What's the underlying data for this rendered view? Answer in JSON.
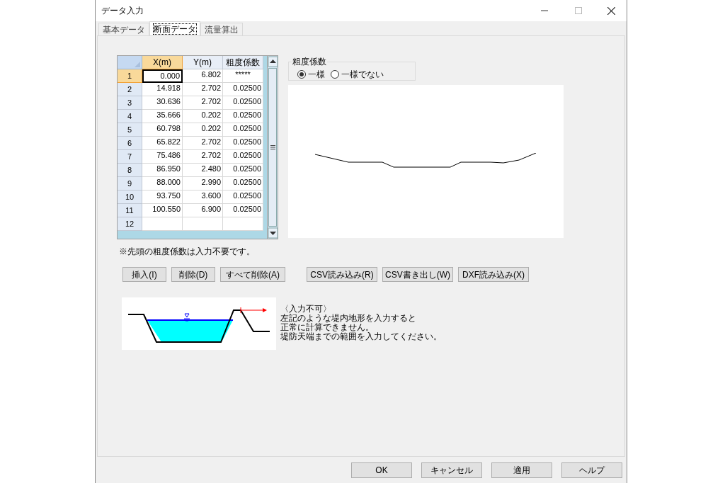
{
  "window": {
    "title": "データ入力"
  },
  "tabs": [
    {
      "label": "基本データ",
      "selected": false
    },
    {
      "label": "断面データ",
      "selected": true
    },
    {
      "label": "流量算出",
      "selected": false
    }
  ],
  "table": {
    "columns": [
      {
        "label": "X(m)",
        "selected": true
      },
      {
        "label": "Y(m)",
        "selected": false
      },
      {
        "label": "粗度係数",
        "selected": false
      }
    ],
    "rows": [
      {
        "number": "1",
        "selected": true,
        "cells": [
          "0.000",
          "6.802",
          "*****"
        ]
      },
      {
        "number": "2",
        "selected": false,
        "cells": [
          "14.918",
          "2.702",
          "0.02500"
        ]
      },
      {
        "number": "3",
        "selected": false,
        "cells": [
          "30.636",
          "2.702",
          "0.02500"
        ]
      },
      {
        "number": "4",
        "selected": false,
        "cells": [
          "35.666",
          "0.202",
          "0.02500"
        ]
      },
      {
        "number": "5",
        "selected": false,
        "cells": [
          "60.798",
          "0.202",
          "0.02500"
        ]
      },
      {
        "number": "6",
        "selected": false,
        "cells": [
          "65.822",
          "2.702",
          "0.02500"
        ]
      },
      {
        "number": "7",
        "selected": false,
        "cells": [
          "75.486",
          "2.702",
          "0.02500"
        ]
      },
      {
        "number": "8",
        "selected": false,
        "cells": [
          "86.950",
          "2.480",
          "0.02500"
        ]
      },
      {
        "number": "9",
        "selected": false,
        "cells": [
          "88.000",
          "2.990",
          "0.02500"
        ]
      },
      {
        "number": "10",
        "selected": false,
        "cells": [
          "93.750",
          "3.600",
          "0.02500"
        ]
      },
      {
        "number": "11",
        "selected": false,
        "cells": [
          "100.550",
          "6.900",
          "0.02500"
        ]
      },
      {
        "number": "12",
        "selected": false,
        "cells": []
      }
    ]
  },
  "roughness": {
    "label": "粗度係数",
    "options": [
      {
        "label": "一様",
        "selected": true
      },
      {
        "label": "一様でない",
        "selected": false
      }
    ]
  },
  "note": "※先頭の粗度係数は入力不要です。",
  "row_buttons": [
    "挿入(I)",
    "削除(D)",
    "すべて削除(A)"
  ],
  "file_buttons": [
    "CSV読み込み(R)",
    "CSV書き出し(W)",
    "DXF読み込み(X)"
  ],
  "warning": [
    "〈入力不可〉",
    "左記のような堤内地形を入力すると",
    "正常に計算できません。",
    "堤防天端までの範囲を入力してください。"
  ],
  "footer_buttons": [
    "OK",
    "キャンセル",
    "適用",
    "ヘルプ"
  ]
}
